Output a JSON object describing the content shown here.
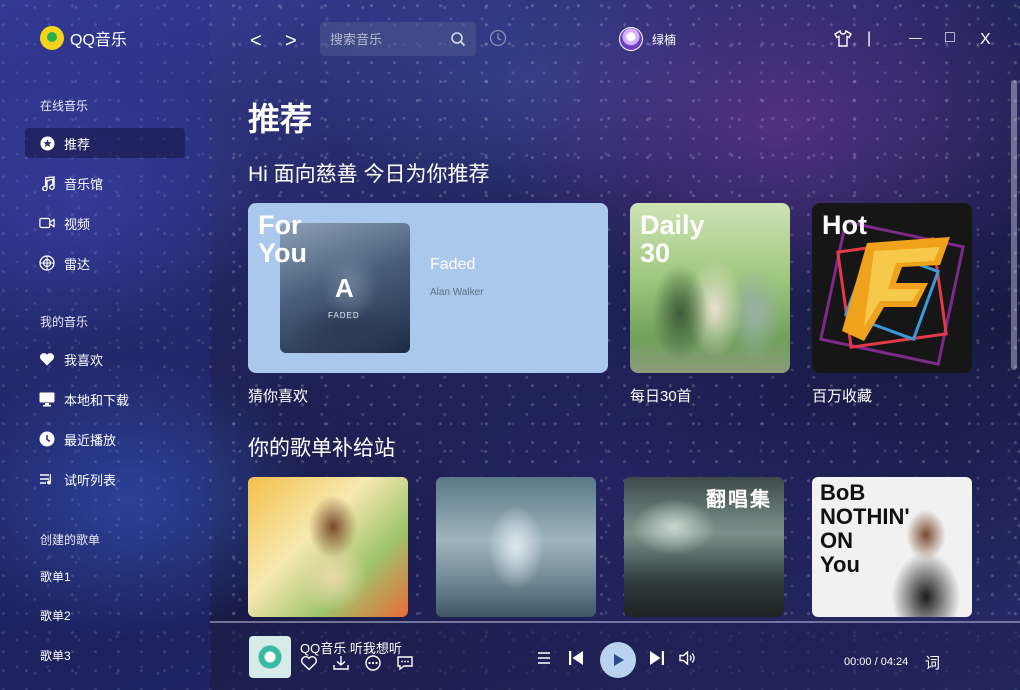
{
  "app": {
    "name": "QQ音乐"
  },
  "sidebar": {
    "online_label": "在线音乐",
    "online_items": [
      {
        "label": "推荐",
        "icon": "star-icon"
      },
      {
        "label": "音乐馆",
        "icon": "music-note-icon"
      },
      {
        "label": "视频",
        "icon": "video-icon"
      },
      {
        "label": "雷达",
        "icon": "radar-icon"
      }
    ],
    "my_label": "我的音乐",
    "my_items": [
      {
        "label": "我喜欢",
        "icon": "heart-icon"
      },
      {
        "label": "本地和下载",
        "icon": "monitor-icon"
      },
      {
        "label": "最近播放",
        "icon": "clock-icon"
      },
      {
        "label": "试听列表",
        "icon": "playlist-icon"
      }
    ],
    "created_label": "创建的歌单",
    "playlists": [
      "歌单1",
      "歌单2",
      "歌单3"
    ]
  },
  "topbar": {
    "back": "<",
    "forward": ">",
    "search_placeholder": "搜索音乐",
    "username": "绿楠",
    "skin_icon": "shirt-icon",
    "divider": "|",
    "minimize": "—",
    "maximize": "□",
    "close": "X"
  },
  "main": {
    "page_title": "推荐",
    "greeting": "Hi 面向慈善 今日为你推荐",
    "foryou": {
      "title_line1": "For",
      "title_line2": "You",
      "cover_mark": "A",
      "cover_caption": "FADED",
      "song": "Faded",
      "artist": "Alan Walker",
      "label": "猜你喜欢"
    },
    "daily": {
      "title_line1": "Daily",
      "title_line2": "30",
      "label": "每日30首"
    },
    "hot": {
      "title": "Hot",
      "label": "百万收藏"
    },
    "section2_title": "你的歌单补给站",
    "albums": [
      {
        "name": "album-anime-girl"
      },
      {
        "name": "album-misty-city"
      },
      {
        "name": "album-fanchangji",
        "title": "翻唱集"
      },
      {
        "name": "album-bob",
        "title_line1": "BoB",
        "title_line2": "NOTHIN'",
        "title_line3": "ON",
        "title_line4": "You"
      }
    ]
  },
  "player": {
    "title": "QQ音乐 听我想听",
    "time": "00:00 / 04:24",
    "lyric": "词",
    "accent": "#b9d2ef"
  }
}
